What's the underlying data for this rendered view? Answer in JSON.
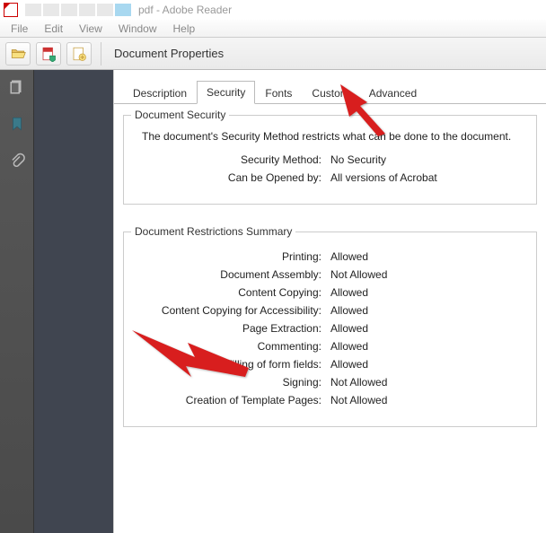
{
  "titlebar": {
    "title": "pdf - Adobe Reader"
  },
  "menubar": {
    "items": [
      "File",
      "Edit",
      "View",
      "Window",
      "Help"
    ]
  },
  "dialog": {
    "title": "Document Properties",
    "tabs": [
      "Description",
      "Security",
      "Fonts",
      "Custom",
      "Advanced"
    ],
    "active_tab": "Security"
  },
  "security_group": {
    "title": "Document Security",
    "intro": "The document's Security Method restricts what can be done to the document.",
    "method_label": "Security Method:",
    "method_value": "No Security",
    "opened_label": "Can be Opened by:",
    "opened_value": "All versions of Acrobat"
  },
  "restrictions": {
    "title": "Document Restrictions Summary",
    "rows": [
      {
        "label": "Printing:",
        "value": "Allowed"
      },
      {
        "label": "Document Assembly:",
        "value": "Not Allowed"
      },
      {
        "label": "Content Copying:",
        "value": "Allowed"
      },
      {
        "label": "Content Copying for Accessibility:",
        "value": "Allowed"
      },
      {
        "label": "Page Extraction:",
        "value": "Allowed"
      },
      {
        "label": "Commenting:",
        "value": "Allowed"
      },
      {
        "label": "Filling of form fields:",
        "value": "Allowed"
      },
      {
        "label": "Signing:",
        "value": "Not Allowed"
      },
      {
        "label": "Creation of Template Pages:",
        "value": "Not Allowed"
      }
    ]
  }
}
